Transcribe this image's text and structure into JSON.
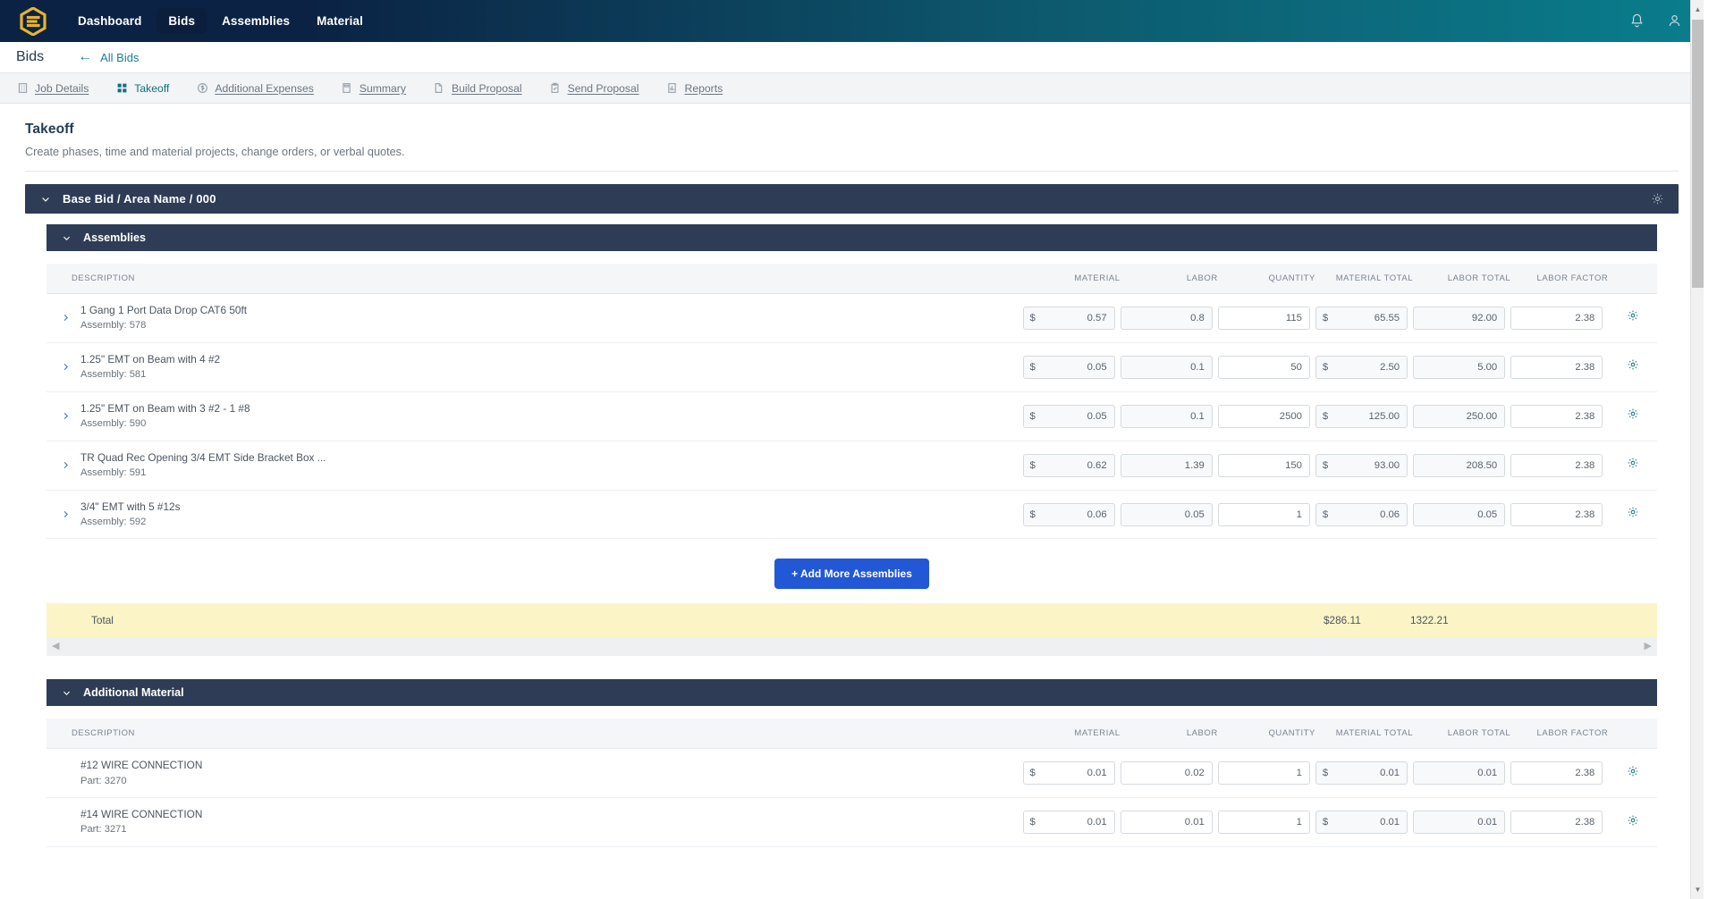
{
  "app": {
    "logo_icon": "hexagon-e-logo",
    "nav_items": [
      {
        "label": "Dashboard",
        "active": false
      },
      {
        "label": "Bids",
        "active": true
      },
      {
        "label": "Assemblies",
        "active": false
      },
      {
        "label": "Material",
        "active": false
      }
    ],
    "notification_icon": "bell-icon",
    "account_icon": "user-icon"
  },
  "bidsbar": {
    "title": "Bids",
    "back_label": "All Bids",
    "back_icon": "arrow-left-icon"
  },
  "subtabs": [
    {
      "label": "Job Details",
      "icon": "building-icon",
      "active": false
    },
    {
      "label": "Takeoff",
      "icon": "grid-squares-icon",
      "active": true
    },
    {
      "label": "Additional Expenses",
      "icon": "dollar-circle-icon",
      "active": false
    },
    {
      "label": "Summary",
      "icon": "calculator-icon",
      "active": false
    },
    {
      "label": "Build Proposal",
      "icon": "document-icon",
      "active": false
    },
    {
      "label": "Send Proposal",
      "icon": "clipboard-check-icon",
      "active": false
    },
    {
      "label": "Reports",
      "icon": "chart-bars-icon",
      "active": false
    }
  ],
  "page": {
    "title": "Takeoff",
    "subtitle": "Create phases, time and material projects, change orders, or verbal quotes."
  },
  "phase": {
    "title": "Base Bid / Area Name / 000",
    "collapse_icon": "chevron-down-icon",
    "settings_icon": "gear-icon"
  },
  "columns": {
    "description": "DESCRIPTION",
    "material": "MATERIAL",
    "labor": "LABOR",
    "quantity": "QUANTITY",
    "material_total": "MATERIAL TOTAL",
    "labor_total": "LABOR TOTAL",
    "labor_factor": "LABOR FACTOR"
  },
  "assemblies": {
    "section_title": "Assemblies",
    "rows": [
      {
        "name": "1 Gang 1 Port Data Drop CAT6 50ft",
        "sub": "Assembly: 578",
        "material": "0.57",
        "labor": "0.8",
        "quantity": "115",
        "material_total": "65.55",
        "labor_total": "92.00",
        "labor_factor": "2.38",
        "currency": "$"
      },
      {
        "name": "1.25\" EMT on Beam with 4 #2",
        "sub": "Assembly: 581",
        "material": "0.05",
        "labor": "0.1",
        "quantity": "50",
        "material_total": "2.50",
        "labor_total": "5.00",
        "labor_factor": "2.38",
        "currency": "$"
      },
      {
        "name": "1.25\" EMT on Beam with 3 #2 - 1 #8",
        "sub": "Assembly: 590",
        "material": "0.05",
        "labor": "0.1",
        "quantity": "2500",
        "material_total": "125.00",
        "labor_total": "250.00",
        "labor_factor": "2.38",
        "currency": "$"
      },
      {
        "name": "TR Quad Rec Opening 3/4 EMT Side Bracket Box ...",
        "sub": "Assembly: 591",
        "material": "0.62",
        "labor": "1.39",
        "quantity": "150",
        "material_total": "93.00",
        "labor_total": "208.50",
        "labor_factor": "2.38",
        "currency": "$"
      },
      {
        "name": "3/4\" EMT with 5 #12s",
        "sub": "Assembly: 592",
        "material": "0.06",
        "labor": "0.05",
        "quantity": "1",
        "material_total": "0.06",
        "labor_total": "0.05",
        "labor_factor": "2.38",
        "currency": "$"
      }
    ],
    "add_button": "+ Add More Assemblies",
    "total_label": "Total",
    "total_material": "$286.11",
    "total_labor": "1322.21"
  },
  "additional_material": {
    "section_title": "Additional Material",
    "rows": [
      {
        "name": "#12 WIRE CONNECTION",
        "sub": "Part: 3270",
        "material": "0.01",
        "labor": "0.02",
        "quantity": "1",
        "material_total": "0.01",
        "labor_total": "0.01",
        "labor_factor": "2.38",
        "currency": "$"
      },
      {
        "name": "#14 WIRE CONNECTION",
        "sub": "Part: 3271",
        "material": "0.01",
        "labor": "0.01",
        "quantity": "1",
        "material_total": "0.01",
        "labor_total": "0.01",
        "labor_factor": "2.38",
        "currency": "$"
      }
    ]
  },
  "colors": {
    "nav_dark": "#0b2244",
    "nav_teal": "#0a7d8c",
    "section_header": "#2e3c55",
    "accent_teal": "#12707f",
    "primary_button": "#2257d6",
    "total_row": "#fbf4c7",
    "logo_gold": "#e8b42a"
  }
}
